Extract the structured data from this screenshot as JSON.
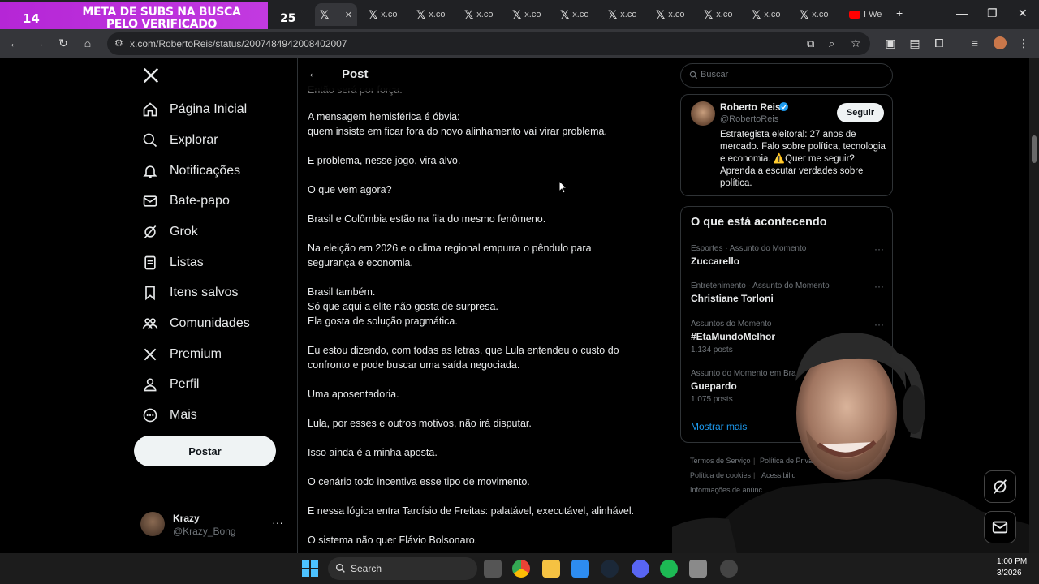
{
  "browser": {
    "overlay_count": "14",
    "overlay_text": "META DE SUBS NA BUSCA PELO VERIFICADO",
    "overlay_count2": "25",
    "tab_label": "x.co",
    "last_tab_label": "I We",
    "url": "x.com/RobertoReis/status/2007484942008402007"
  },
  "nav": {
    "items": [
      {
        "label": "Página Inicial",
        "icon": "home-icon"
      },
      {
        "label": "Explorar",
        "icon": "search-icon"
      },
      {
        "label": "Notificações",
        "icon": "bell-icon"
      },
      {
        "label": "Bate-papo",
        "icon": "mail-icon"
      },
      {
        "label": "Grok",
        "icon": "grok-icon"
      },
      {
        "label": "Listas",
        "icon": "list-icon"
      },
      {
        "label": "Itens salvos",
        "icon": "bookmark-icon"
      },
      {
        "label": "Comunidades",
        "icon": "communities-icon"
      },
      {
        "label": "Premium",
        "icon": "x-logo-icon"
      },
      {
        "label": "Perfil",
        "icon": "person-icon"
      },
      {
        "label": "Mais",
        "icon": "more-circle-icon"
      }
    ],
    "post_button": "Postar",
    "account": {
      "name": "Krazy",
      "handle": "@Krazy_Bong"
    }
  },
  "main": {
    "title": "Post",
    "paragraphs": [
      "Então será por força.",
      "A mensagem hemisférica é óbvia:\nquem insiste em ficar fora do novo alinhamento vai virar problema.",
      "E problema, nesse jogo, vira alvo.",
      "O que vem agora?",
      "Brasil e Colômbia estão na fila do mesmo fenômeno.",
      "Na eleição em 2026 e o clima regional empurra o pêndulo para segurança e economia.",
      "Brasil também.\nSó que aqui a elite não gosta de surpresa.\nEla gosta de solução pragmática.",
      "Eu estou dizendo, com todas as letras, que Lula entendeu o custo do confronto e pode buscar uma saída negociada.",
      "Uma aposentadoria.",
      "Lula, por esses e outros motivos, não irá disputar.",
      "Isso ainda é a minha aposta.",
      "O cenário todo incentiva esse tipo de movimento.",
      "E nessa lógica entra Tarcísio de Freitas: palatável, executável, alinhável.",
      "O sistema não quer Flávio Bolsonaro."
    ]
  },
  "search": {
    "placeholder": "Buscar"
  },
  "profile": {
    "name": "Roberto Reis",
    "handle": "@RobertoReis",
    "bio": "Estrategista eleitoral: 27 anos de mercado. Falo sobre política, tecnologia e economia. ⚠️Quer me seguir? Aprenda a escutar verdades sobre política.",
    "follow": "Seguir"
  },
  "trends": {
    "title": "O que está acontecendo",
    "items": [
      {
        "category": "Esportes · Assunto do Momento",
        "name": "Zuccarello",
        "count": ""
      },
      {
        "category": "Entretenimento · Assunto do Momento",
        "name": "Christiane Torloni",
        "count": ""
      },
      {
        "category": "Assuntos do Momento",
        "name": "#EtaMundoMelhor",
        "count": "1.134 posts"
      },
      {
        "category": "Assunto do Momento em Bra",
        "name": "Guepardo",
        "count": "1.075 posts"
      }
    ],
    "show_more": "Mostrar mais"
  },
  "footer": {
    "links": [
      "Termos de Serviço",
      "Política de Privacidad",
      "Política de cookies",
      "Acessibilid",
      "Informações de anúnc"
    ]
  },
  "taskbar": {
    "search_label": "Search",
    "time": "1:00 PM",
    "date": "3/2026"
  },
  "colors": {
    "accent": "#1d9bf0",
    "overlay": "#c23ae0",
    "verified": "#1d9bf0"
  }
}
